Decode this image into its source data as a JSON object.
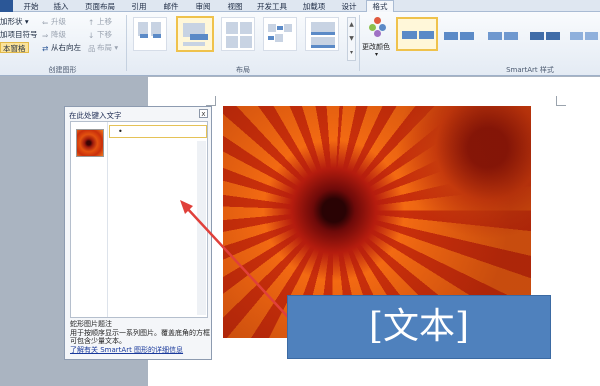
{
  "tabs": [
    "开始",
    "插入",
    "页面布局",
    "引用",
    "邮件",
    "审阅",
    "视图",
    "开发工具",
    "加载项",
    "设计",
    "格式"
  ],
  "ribbon": {
    "create_graphic": {
      "add_shape": "加形状 ▾",
      "add_bullet": "加项目符号",
      "text_pane": "本窗格",
      "promote": "升级",
      "demote": "降级",
      "right_to_left": "从右向左",
      "move_up": "上移",
      "move_down": "下移",
      "layout": "布局 ▾",
      "label": "创建图形"
    },
    "layouts_label": "布局",
    "change_colors": "更改颜色",
    "smartart_styles_label": "SmartArt 样式"
  },
  "text_pane": {
    "title": "在此处键入文字",
    "close": "x",
    "bullet": "•",
    "desc_line1": "蛇形图片题注",
    "desc_body": "用于按顺序显示一系列图片。覆盖底角的方框可包含少量文本。",
    "learn_more": "了解有关 SmartArt 图形的详细信息"
  },
  "callout": {
    "text": "[文本]"
  },
  "colors": {
    "accent": "#4f81bd",
    "highlight": "#efc24c",
    "arrow": "#e0403a"
  }
}
